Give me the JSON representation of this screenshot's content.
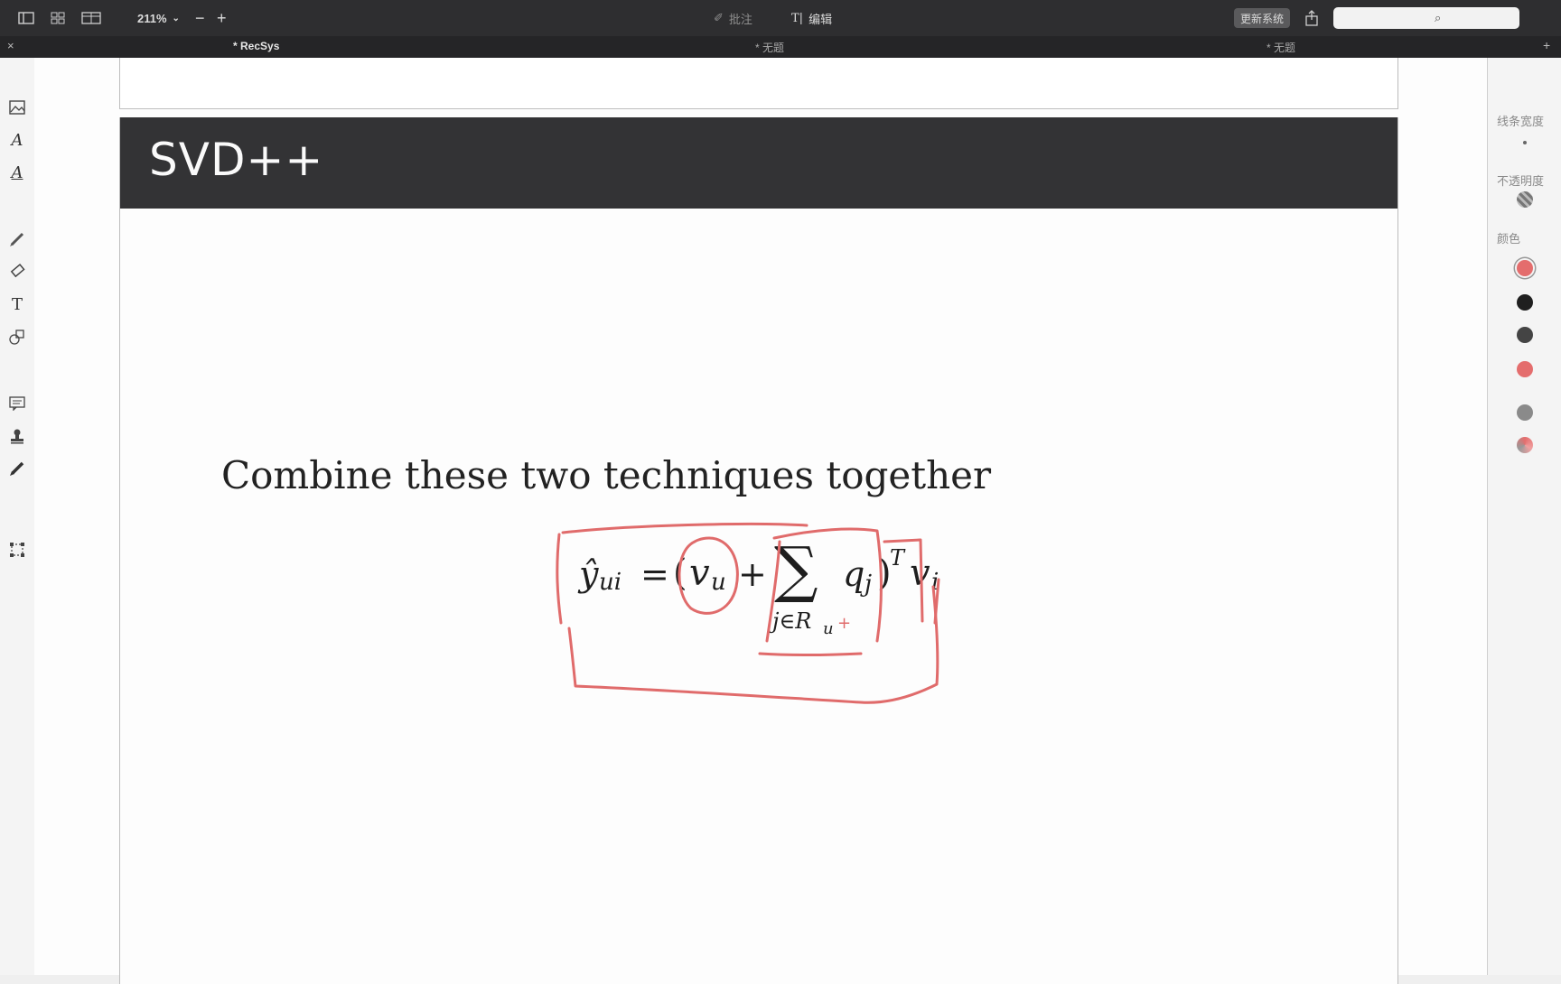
{
  "toolbar": {
    "zoom": "211%",
    "zoom_out": "−",
    "zoom_in": "+",
    "annotate_label": "批注",
    "edit_label": "编辑",
    "update_button": "更新系统",
    "search_placeholder": ""
  },
  "tabs": [
    {
      "label": "* RecSys",
      "active": true
    },
    {
      "label": "* 无题",
      "active": false
    },
    {
      "label": "* 无题",
      "active": false
    }
  ],
  "tab_close": "×",
  "tab_add": "+",
  "slide": {
    "title": "SVD++",
    "text": "Combine these two techniques together"
  },
  "equation": {
    "lhs": "ŷ",
    "lhs_sub": "ui",
    "equals": "=",
    "open_paren": "(",
    "v_u": "v",
    "v_u_sub": "u",
    "plus": "+",
    "sum": "∑",
    "sum_sub": "j∈R",
    "sum_sub_u": "u",
    "q_j": "q",
    "q_j_sub": "j",
    "close_paren": ")",
    "sup_T": "T",
    "v_i": "v",
    "v_i_sub": "i",
    "handwritten_plus": "+"
  },
  "panel": {
    "line_width_label": "线条宽度",
    "opacity_label": "不透明度",
    "color_label": "颜色",
    "swatches": [
      "#e46d6d",
      "#1f1f1f",
      "#444444",
      "#e46d6d",
      "#8a8a8a",
      "#d88"
    ]
  },
  "annotation_color": "#e06b6b"
}
